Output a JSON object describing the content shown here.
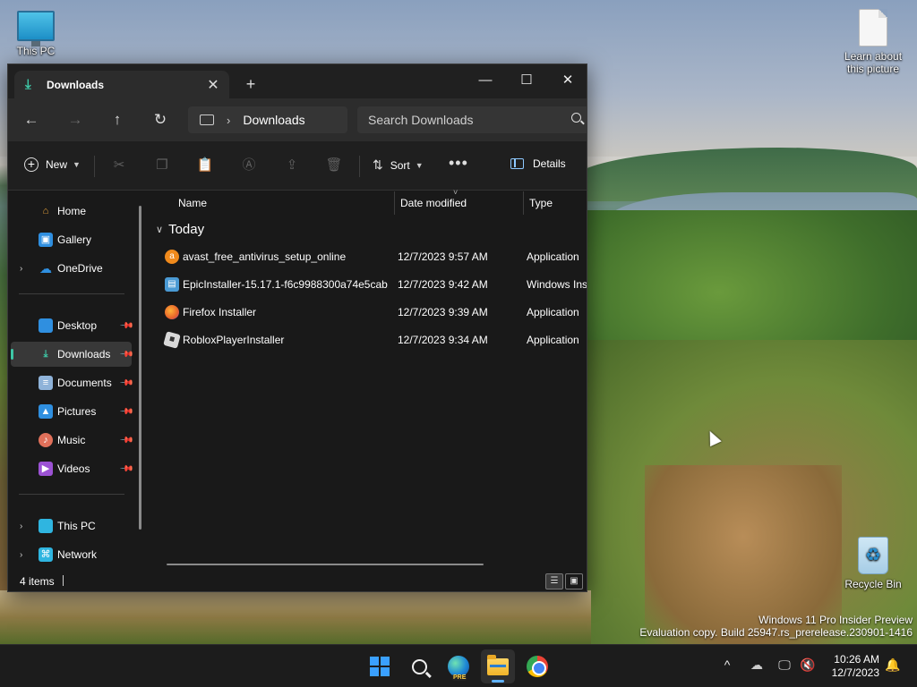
{
  "desktop": {
    "icons": [
      {
        "label": "This PC",
        "icon": "this-pc-icon"
      },
      {
        "label": "Learn about this picture",
        "icon": "document-icon"
      },
      {
        "label": "Recycle Bin",
        "icon": "recycle-bin-icon"
      }
    ],
    "watermark": {
      "line1": "Windows 11 Pro Insider Preview",
      "line2": "Evaluation copy. Build 25947.rs_prerelease.230901-1416"
    }
  },
  "explorer": {
    "tab": {
      "label": "Downloads",
      "icon": "download-icon"
    },
    "window_controls": {
      "minimize": "—",
      "maximize": "☐",
      "close": "✕"
    },
    "nav": {
      "back": "←",
      "forward": "→",
      "up": "↑",
      "refresh": "↻"
    },
    "address": {
      "crumb": "Downloads"
    },
    "search": {
      "placeholder": "Search Downloads"
    },
    "toolbar": {
      "new_label": "New",
      "sort_label": "Sort",
      "more_label": "•••",
      "details_label": "Details"
    },
    "sidebar": {
      "items": [
        {
          "label": "Home",
          "icon": "home-icon",
          "color": "#e8a23a"
        },
        {
          "label": "Gallery",
          "icon": "gallery-icon",
          "color": "#2f8fe0"
        },
        {
          "label": "OneDrive",
          "icon": "onedrive-icon",
          "color": "#2f8fe0"
        },
        {
          "label": "Desktop",
          "icon": "desktop-icon",
          "color": "#2f8fe0"
        },
        {
          "label": "Downloads",
          "icon": "downloads-icon",
          "color": "#3ec7a6"
        },
        {
          "label": "Documents",
          "icon": "documents-icon",
          "color": "#8fb3d9"
        },
        {
          "label": "Pictures",
          "icon": "pictures-icon",
          "color": "#2f8fe0"
        },
        {
          "label": "Music",
          "icon": "music-icon",
          "color": "#e0705a"
        },
        {
          "label": "Videos",
          "icon": "videos-icon",
          "color": "#9c52d4"
        },
        {
          "label": "This PC",
          "icon": "this-pc-icon",
          "color": "#2fb5e0"
        },
        {
          "label": "Network",
          "icon": "network-icon",
          "color": "#2fb5e0"
        }
      ],
      "selected": "Downloads"
    },
    "columns": {
      "name": "Name",
      "date": "Date modified",
      "type": "Type"
    },
    "group": {
      "label": "Today"
    },
    "files": [
      {
        "name": "avast_free_antivirus_setup_online",
        "date": "12/7/2023 9:57 AM",
        "type": "Application",
        "icon": "avast-icon",
        "color": "#f08a1c"
      },
      {
        "name": "EpicInstaller-15.17.1-f6c9988300a74e5cab...",
        "date": "12/7/2023 9:42 AM",
        "type": "Windows Ins",
        "icon": "msi-installer-icon",
        "color": "#4a9ad4"
      },
      {
        "name": "Firefox Installer",
        "date": "12/7/2023 9:39 AM",
        "type": "Application",
        "icon": "firefox-icon",
        "color": "#e8632a"
      },
      {
        "name": "RobloxPlayerInstaller",
        "date": "12/7/2023 9:34 AM",
        "type": "Application",
        "icon": "roblox-icon",
        "color": "#d8d8d8"
      }
    ],
    "status": {
      "items_count": "4 items"
    }
  },
  "taskbar": {
    "apps": [
      "start-icon",
      "search-icon",
      "edge-beta-icon",
      "file-explorer-icon",
      "chrome-icon"
    ],
    "edge_badge": "PRE",
    "tray": {
      "chevron": "^"
    },
    "clock": {
      "time": "10:26 AM",
      "date": "12/7/2023"
    }
  }
}
